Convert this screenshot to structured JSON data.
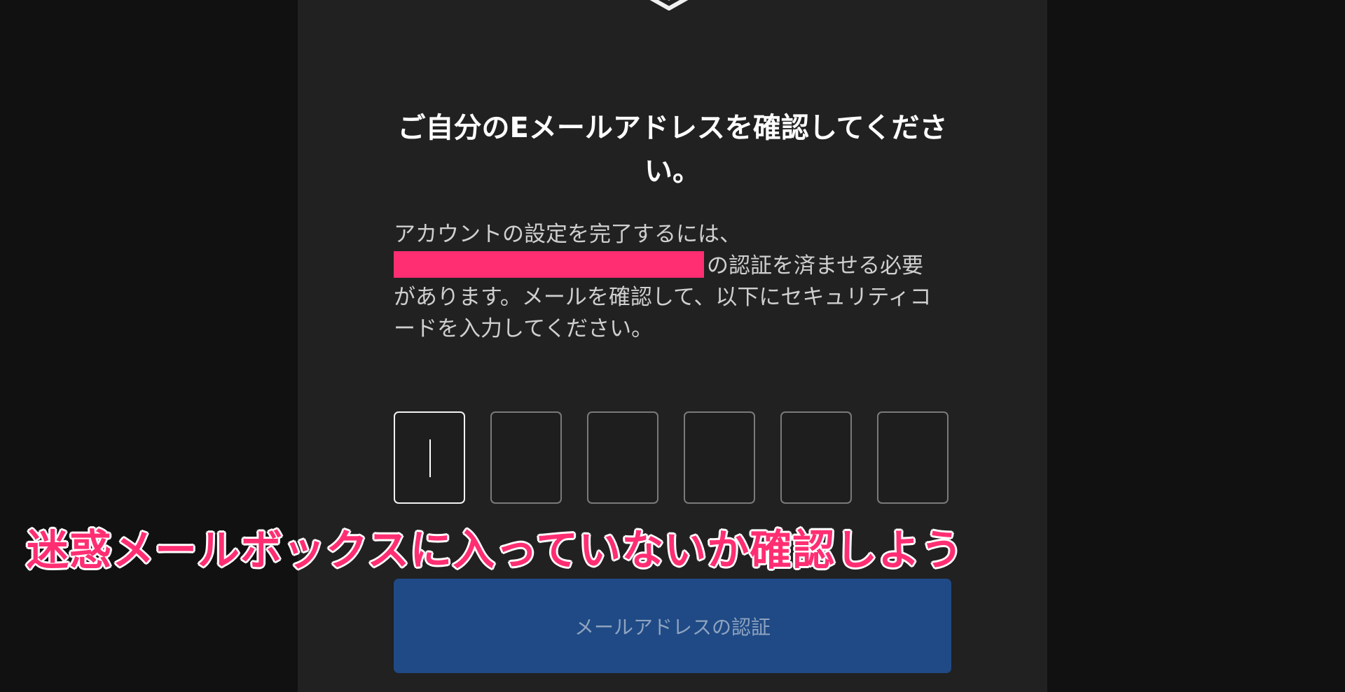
{
  "header": {
    "logo_icon": "shield-logo-icon"
  },
  "main": {
    "title": "ご自分のEメールアドレスを確認してください。",
    "description": {
      "line1": "アカウントの設定を完了するには、",
      "line2_suffix": "の認証を済ませる必要",
      "line3": "があります。メールを確認して、以下にセキュリティコ",
      "line4": "ードを入力してください。"
    },
    "code_inputs": [
      {
        "value": ""
      },
      {
        "value": ""
      },
      {
        "value": ""
      },
      {
        "value": ""
      },
      {
        "value": ""
      },
      {
        "value": ""
      }
    ],
    "verify_button_label": "メールアドレスの認証"
  },
  "overlay": {
    "caption": "迷惑メールボックスに入っていないか確認しよう"
  },
  "colors": {
    "background": "#111111",
    "panel": "#212121",
    "button": "#1f4a85",
    "redaction": "#ff2e72",
    "caption": "#ff2e72"
  }
}
